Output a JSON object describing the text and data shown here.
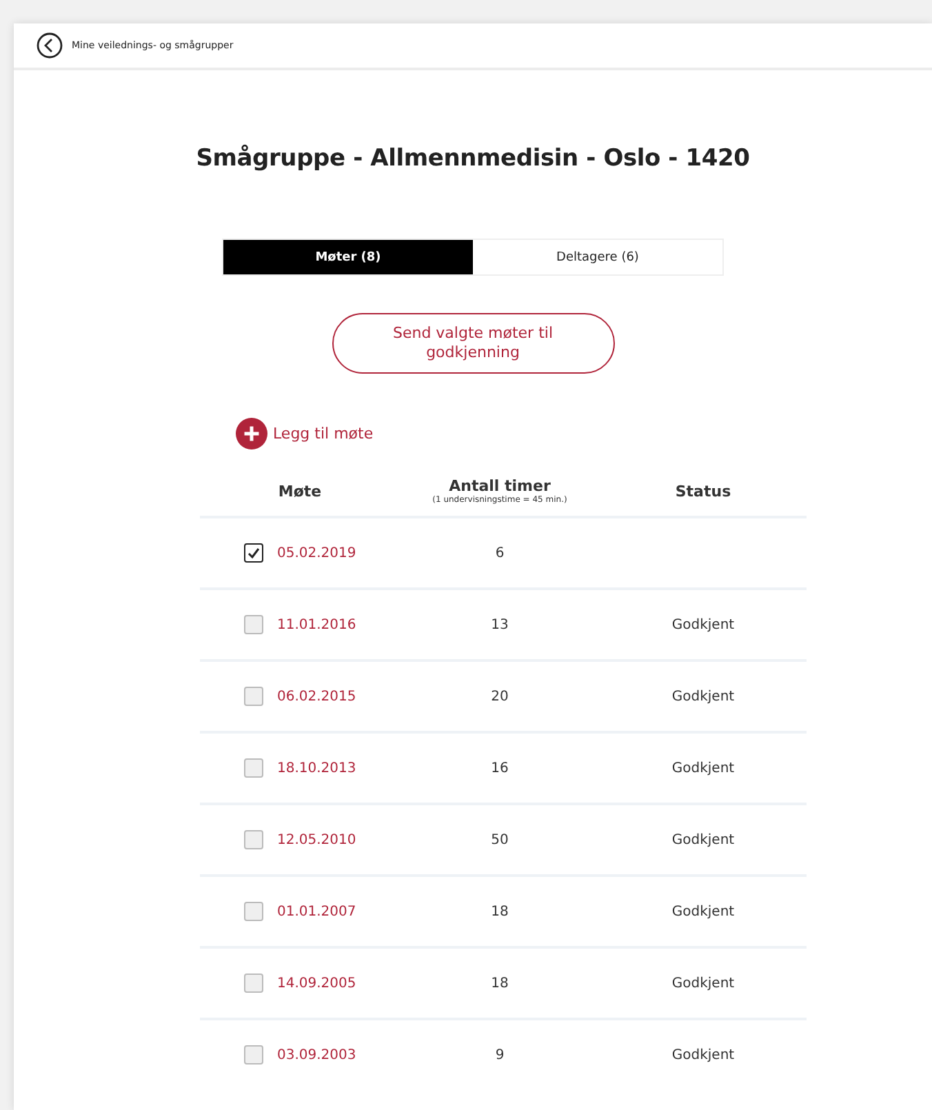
{
  "breadcrumb": {
    "label": "Mine veilednings- og smågrupper"
  },
  "title": "Smågruppe - Allmennmedisin - Oslo - 1420",
  "tabs": [
    {
      "label": "Møter (8)",
      "selected": true
    },
    {
      "label": "Deltagere (6)",
      "selected": false
    }
  ],
  "send_button": "Send valgte møter til godkjenning",
  "add_link": "Legg til møte",
  "table": {
    "columns": [
      {
        "label": "Møte"
      },
      {
        "label": "Antall timer",
        "note": "(1 undervisningstime = 45 min.)"
      },
      {
        "label": "Status"
      }
    ],
    "rows": [
      {
        "checked": true,
        "date": "05.02.2019",
        "hours": "6"
      },
      {
        "checked": false,
        "date": "11.01.2016",
        "hours": "13",
        "status": "Godkjent"
      },
      {
        "checked": false,
        "date": "06.02.2015",
        "hours": "20",
        "status": "Godkjent"
      },
      {
        "checked": false,
        "date": "18.10.2013",
        "hours": "16",
        "status": "Godkjent"
      },
      {
        "checked": false,
        "date": "12.05.2010",
        "hours": "50",
        "status": "Godkjent"
      },
      {
        "checked": false,
        "date": "01.01.2007",
        "hours": "18",
        "status": "Godkjent"
      },
      {
        "checked": false,
        "date": "14.09.2005",
        "hours": "18",
        "status": "Godkjent"
      },
      {
        "checked": false,
        "date": "03.09.2003",
        "hours": "9",
        "status": "Godkjent"
      }
    ]
  }
}
